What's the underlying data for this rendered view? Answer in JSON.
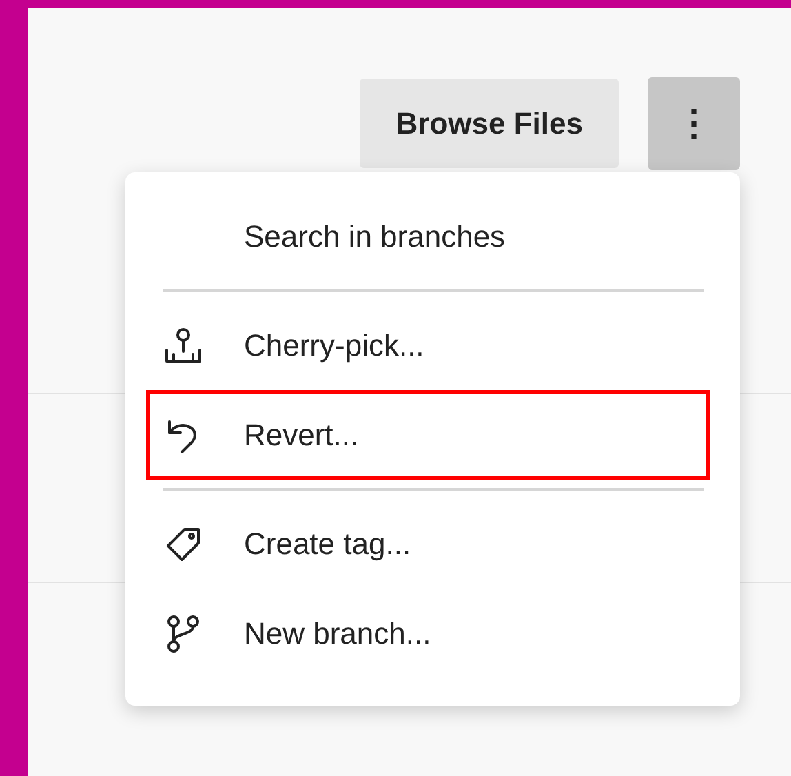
{
  "toolbar": {
    "buttons": [
      {
        "label": "Browse Files",
        "kind": "text",
        "pressed": false
      },
      {
        "label": "⋮",
        "kind": "more",
        "pressed": true
      }
    ]
  },
  "menu": {
    "items": [
      {
        "kind": "plain",
        "label": "Search in branches",
        "highlighted": false
      },
      {
        "kind": "divider"
      },
      {
        "kind": "cherrypick",
        "label": "Cherry-pick...",
        "highlighted": false
      },
      {
        "kind": "revert",
        "label": "Revert...",
        "highlighted": true
      },
      {
        "kind": "divider"
      },
      {
        "kind": "tag",
        "label": "Create tag...",
        "highlighted": false
      },
      {
        "kind": "branch",
        "label": "New branch...",
        "highlighted": false
      }
    ]
  }
}
